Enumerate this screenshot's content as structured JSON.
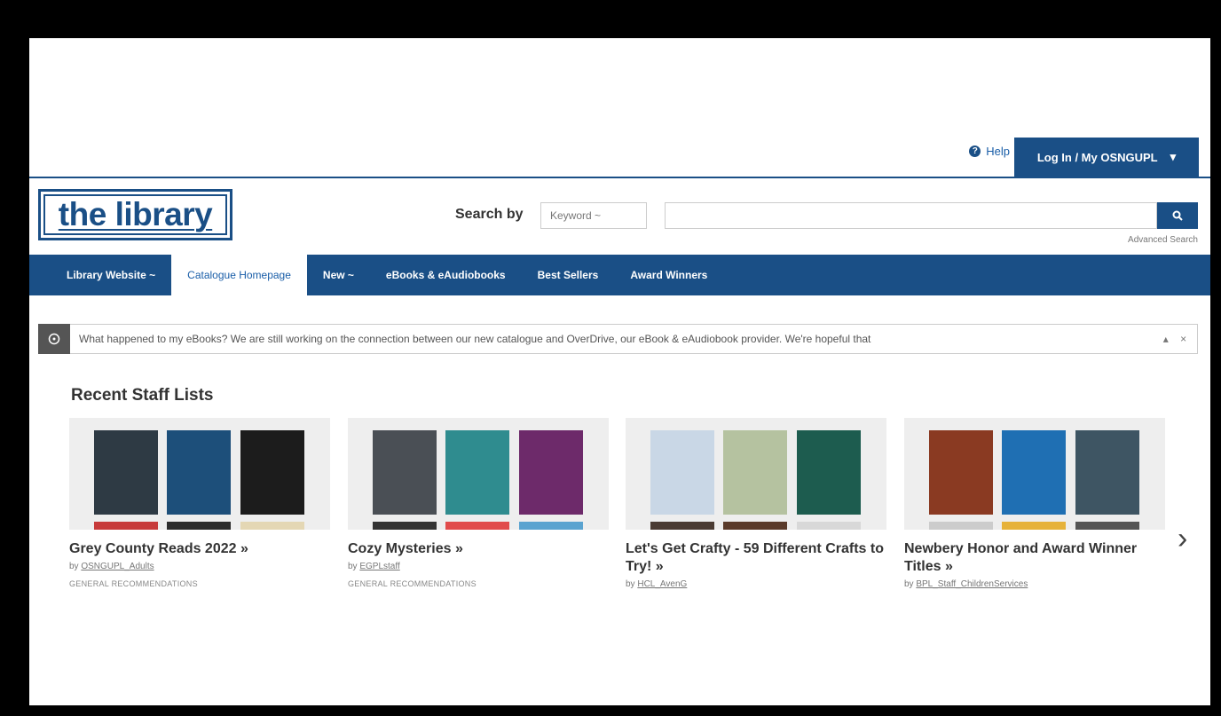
{
  "topbar": {
    "help": "Help",
    "login": "Log In / My OSNGUPL"
  },
  "header": {
    "logo_text": "the library",
    "search_by_label": "Search by",
    "search_type": "Keyword",
    "search_value": "",
    "advanced_search": "Advanced Search"
  },
  "nav": [
    {
      "label": "Library Website ~",
      "active": false
    },
    {
      "label": "Catalogue Homepage",
      "active": true
    },
    {
      "label": "New ~",
      "active": false
    },
    {
      "label": "eBooks & eAudiobooks",
      "active": false
    },
    {
      "label": "Best Sellers",
      "active": false
    },
    {
      "label": "Award Winners",
      "active": false
    }
  ],
  "alert": {
    "message": "What happened to my eBooks? We are still working on the connection between our new catalogue and OverDrive, our eBook & eAudiobook provider. We're hopeful that"
  },
  "section_title": "Recent Staff Lists",
  "lists": [
    {
      "title": "Grey County Reads 2022 »",
      "by_prefix": "by",
      "author": "OSNGUPL_Adults",
      "category": "GENERAL RECOMMENDATIONS",
      "covers": [
        "#2e3a44",
        "#1d4f7a",
        "#1c1c1c"
      ],
      "covers_bottom": [
        "#c73a3a",
        "#2c2c2c",
        "#e4d7b4"
      ]
    },
    {
      "title": "Cozy Mysteries »",
      "by_prefix": "by",
      "author": "EGPLstaff",
      "category": "GENERAL RECOMMENDATIONS",
      "covers": [
        "#4a4f55",
        "#2f8c8f",
        "#6d2a6a"
      ],
      "covers_bottom": [
        "#333333",
        "#e14b4b",
        "#5aa3d0"
      ]
    },
    {
      "title": "Let's Get Crafty - 59 Different Crafts to Try! »",
      "by_prefix": "by",
      "author": "HCL_AvenG",
      "category": "",
      "covers": [
        "#c9d7e6",
        "#b5c2a0",
        "#1d5c4f"
      ],
      "covers_bottom": [
        "#4a3b33",
        "#5a3a2a",
        "#d8d8d8"
      ]
    },
    {
      "title": "Newbery Honor and Award Winner Titles »",
      "by_prefix": "by",
      "author": "BPL_Staff_ChildrenServices",
      "category": "",
      "covers": [
        "#8a3a22",
        "#1f6fb3",
        "#3e5563"
      ],
      "covers_bottom": [
        "#cccccc",
        "#e6b23a",
        "#555555"
      ]
    }
  ]
}
